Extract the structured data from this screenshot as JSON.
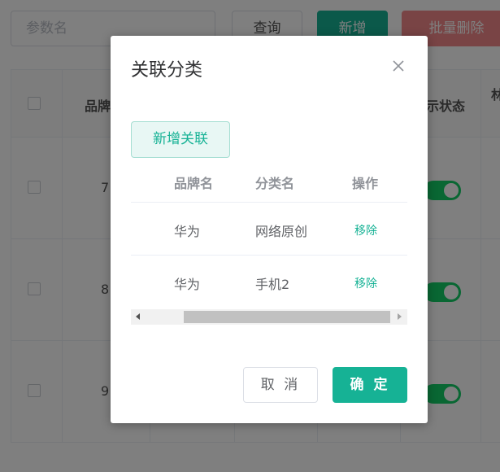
{
  "toolbar": {
    "search_placeholder": "参数名",
    "query_label": "查询",
    "add_label": "新增",
    "batch_delete_label": "批量删除"
  },
  "main_table": {
    "headers": [
      "品牌",
      "示状态",
      "林"
    ],
    "rows": [
      {
        "id_partial": "7"
      },
      {
        "id_partial": "8"
      },
      {
        "id_partial": "9"
      }
    ]
  },
  "dialog": {
    "title": "关联分类",
    "add_relation_label": "新增关联",
    "columns": [
      "品牌名",
      "分类名",
      "操作"
    ],
    "rows": [
      {
        "brand": "华为",
        "category": "网络原创",
        "action": "移除"
      },
      {
        "brand": "华为",
        "category": "手机2",
        "action": "移除"
      }
    ],
    "cancel_label": "取 消",
    "confirm_label": "确 定"
  },
  "colors": {
    "accent": "#16b295",
    "danger_light": "#f2898a",
    "switch_on": "#13ce66"
  }
}
